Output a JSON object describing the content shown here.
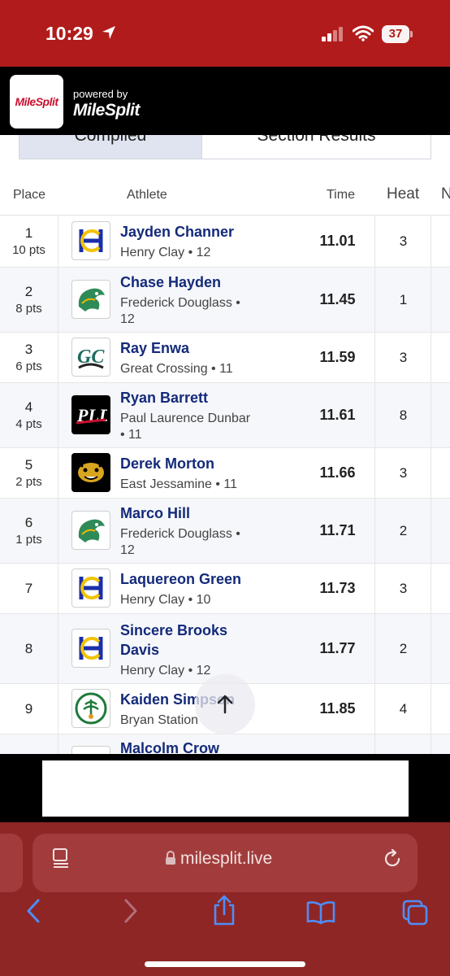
{
  "status_bar": {
    "time": "10:29",
    "battery": "37"
  },
  "header": {
    "logo_text": "MileSplit",
    "powered_by": "powered by",
    "brand": "MileSplit"
  },
  "tabs": [
    {
      "label": "Compiled"
    },
    {
      "label": "Section Results"
    }
  ],
  "table": {
    "columns": {
      "place": "Place",
      "athlete": "Athlete",
      "time": "Time",
      "heat": "Heat",
      "more": "N"
    },
    "rows": [
      {
        "place": "1",
        "pts": "10 pts",
        "name": "Jayden Channer",
        "school": "Henry Clay • 12",
        "time": "11.01",
        "heat": "3",
        "logo": "henry-clay-logo"
      },
      {
        "place": "2",
        "pts": "8 pts",
        "name": "Chase Hayden",
        "school": "Frederick Douglass • 12",
        "time": "11.45",
        "heat": "1",
        "logo": "frederick-douglass-logo"
      },
      {
        "place": "3",
        "pts": "6 pts",
        "name": "Ray Enwa",
        "school": "Great Crossing • 11",
        "time": "11.59",
        "heat": "3",
        "logo": "great-crossing-logo"
      },
      {
        "place": "4",
        "pts": "4 pts",
        "name": "Ryan Barrett",
        "school": "Paul Laurence Dunbar • 11",
        "time": "11.61",
        "heat": "8",
        "logo": "dunbar-logo"
      },
      {
        "place": "5",
        "pts": "2 pts",
        "name": "Derek Morton",
        "school": "East Jessamine • 11",
        "time": "11.66",
        "heat": "3",
        "logo": "east-jessamine-logo"
      },
      {
        "place": "6",
        "pts": "1 pts",
        "name": "Marco Hill",
        "school": "Frederick Douglass • 12",
        "time": "11.71",
        "heat": "2",
        "logo": "frederick-douglass-logo"
      },
      {
        "place": "7",
        "pts": "",
        "name": "Laquereon Green",
        "school": "Henry Clay • 10",
        "time": "11.73",
        "heat": "3",
        "logo": "henry-clay-logo"
      },
      {
        "place": "8",
        "pts": "",
        "name": "Sincere Brooks Davis",
        "school": "Henry Clay • 12",
        "time": "11.77",
        "heat": "2",
        "logo": "henry-clay-logo"
      },
      {
        "place": "9",
        "pts": "",
        "name": "Kaiden Simpson",
        "school": "Bryan Station",
        "time": "11.85",
        "heat": "4",
        "logo": "bryan-station-logo"
      },
      {
        "place": "",
        "pts": "",
        "name": "Malcolm Crow",
        "school": "",
        "time": "",
        "heat": "",
        "logo": ""
      }
    ]
  },
  "browser": {
    "url": "milesplit.live"
  },
  "colors": {
    "status_bar": "#b21b1b",
    "name_link": "#142a7a",
    "safari_bar": "#8e2626"
  }
}
